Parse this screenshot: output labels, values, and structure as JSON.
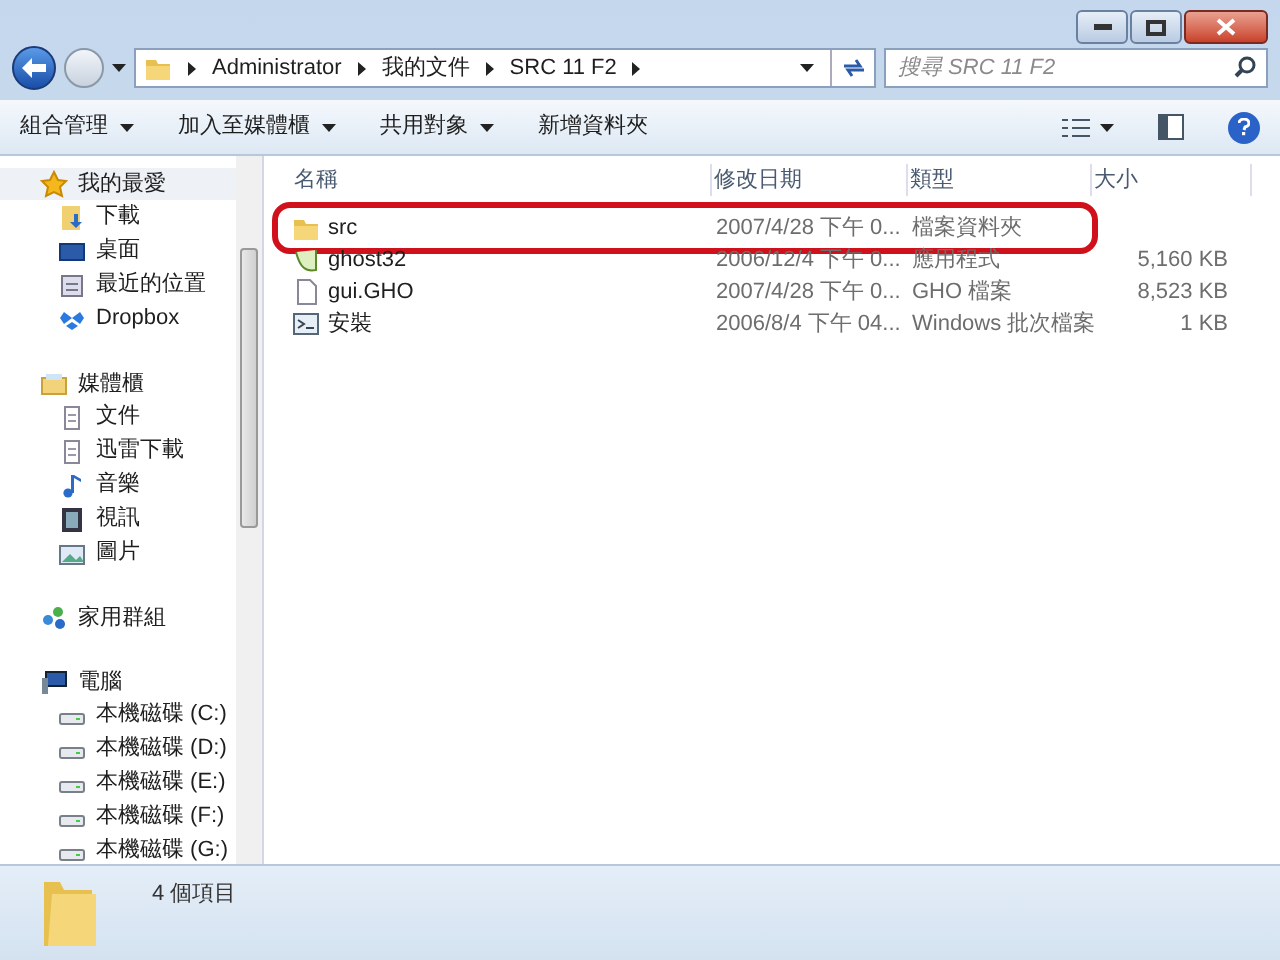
{
  "address": {
    "crumbs": [
      "Administrator",
      "我的文件",
      "SRC 11 F2"
    ]
  },
  "search": {
    "placeholder": "搜尋 SRC 11 F2"
  },
  "toolbar": {
    "items": [
      "組合管理",
      "加入至媒體櫃",
      "共用對象",
      "新增資料夾"
    ]
  },
  "sidebar": {
    "groups": [
      {
        "label": "我的最愛",
        "kind": "star",
        "selected": true,
        "items": [
          {
            "label": "下載",
            "kind": "download"
          },
          {
            "label": "桌面",
            "kind": "desktop"
          },
          {
            "label": "最近的位置",
            "kind": "recent"
          },
          {
            "label": "Dropbox",
            "kind": "dropbox"
          }
        ]
      },
      {
        "label": "媒體櫃",
        "kind": "library",
        "selected": false,
        "items": [
          {
            "label": "文件",
            "kind": "doc"
          },
          {
            "label": "迅雷下載",
            "kind": "doc"
          },
          {
            "label": "音樂",
            "kind": "music"
          },
          {
            "label": "視訊",
            "kind": "video"
          },
          {
            "label": "圖片",
            "kind": "picture"
          }
        ]
      },
      {
        "label": "家用群組",
        "kind": "homegroup",
        "selected": false
      },
      {
        "label": "電腦",
        "kind": "computer",
        "selected": false,
        "items": [
          {
            "label": "本機磁碟 (C:)",
            "kind": "drive"
          },
          {
            "label": "本機磁碟 (D:)",
            "kind": "drive"
          },
          {
            "label": "本機磁碟 (E:)",
            "kind": "drive"
          },
          {
            "label": "本機磁碟 (F:)",
            "kind": "drive"
          },
          {
            "label": "本機磁碟 (G:)",
            "kind": "drive"
          }
        ]
      }
    ]
  },
  "table": {
    "columns": [
      "名稱",
      "修改日期",
      "類型",
      "大小"
    ],
    "rows": [
      {
        "kind": "folder",
        "highlighted": true,
        "cells": [
          "src",
          "2007/4/28 下午 0...",
          "檔案資料夾",
          ""
        ]
      },
      {
        "kind": "app",
        "highlighted": false,
        "cells": [
          "ghost32",
          "2006/12/4 下午 0...",
          "應用程式",
          "5,160 KB"
        ]
      },
      {
        "kind": "file",
        "highlighted": false,
        "cells": [
          "gui.GHO",
          "2007/4/28 下午 0...",
          "GHO 檔案",
          "8,523 KB"
        ]
      },
      {
        "kind": "batch",
        "highlighted": false,
        "cells": [
          "安裝",
          "2006/8/4 下午 04...",
          "Windows 批次檔案",
          "1 KB"
        ]
      }
    ]
  },
  "status_bar": {
    "text": "4 個項目"
  }
}
